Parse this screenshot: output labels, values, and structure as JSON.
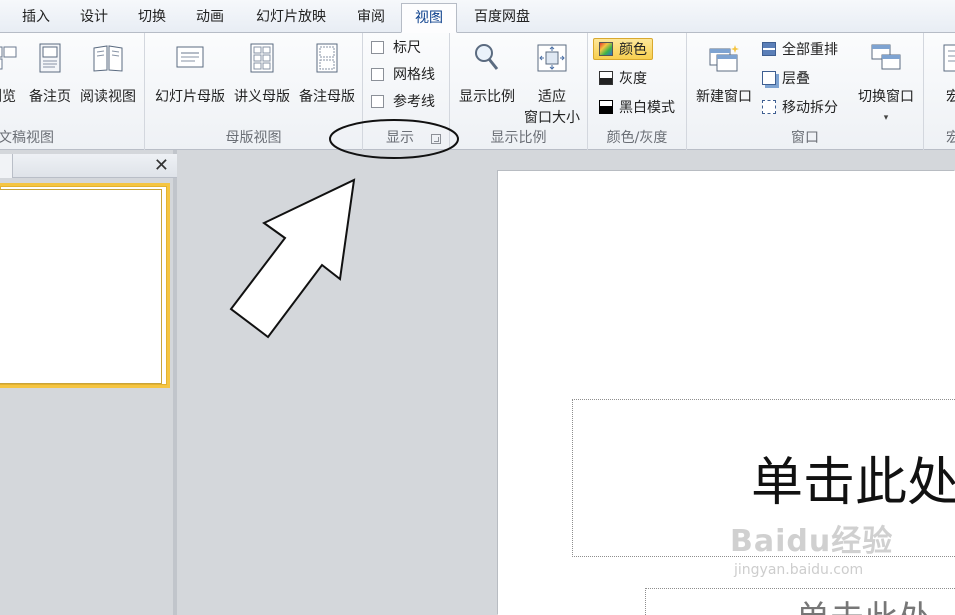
{
  "tabs": [
    {
      "label": "插入"
    },
    {
      "label": "设计"
    },
    {
      "label": "切换"
    },
    {
      "label": "动画"
    },
    {
      "label": "幻灯片放映"
    },
    {
      "label": "审阅"
    },
    {
      "label": "视图",
      "active": true
    },
    {
      "label": "百度网盘"
    }
  ],
  "ribbon": {
    "presentation_views": {
      "label": "文稿视图",
      "buttons": [
        {
          "label": "浏览",
          "icon": "slide-sorter-icon"
        },
        {
          "label": "备注页",
          "icon": "notes-page-icon"
        },
        {
          "label": "阅读视图",
          "icon": "reading-view-icon"
        }
      ]
    },
    "master_views": {
      "label": "母版视图",
      "buttons": [
        {
          "label": "幻灯片母版",
          "icon": "slide-master-icon"
        },
        {
          "label": "讲义母版",
          "icon": "handout-master-icon"
        },
        {
          "label": "备注母版",
          "icon": "notes-master-icon"
        }
      ]
    },
    "show": {
      "label": "显示",
      "checkboxes": [
        {
          "label": "标尺",
          "checked": false
        },
        {
          "label": "网格线",
          "checked": false
        },
        {
          "label": "参考线",
          "checked": false
        }
      ]
    },
    "zoom": {
      "label": "显示比例",
      "zoom_button": "显示比例",
      "fit_line1": "适应",
      "fit_line2": "窗口大小"
    },
    "color": {
      "label": "颜色/灰度",
      "color": "颜色",
      "grayscale": "灰度",
      "bw": "黑白模式"
    },
    "window": {
      "label": "窗口",
      "new_window": "新建窗口",
      "arrange_all": "全部重排",
      "cascade": "层叠",
      "move_split": "移动拆分",
      "switch_windows": "切换窗口"
    },
    "macros": {
      "label": "宏",
      "button": "宏"
    }
  },
  "slide": {
    "title_placeholder": "单击此处",
    "subtitle_placeholder": "单击此处"
  },
  "watermark": {
    "main": "Baidu经验",
    "url": "jingyan.baidu.com"
  },
  "colors": {
    "accent_tab_text": "#0b3f8c",
    "thumbnail_selection": "#f5c542",
    "color_button_fill": "#f8cf4f"
  }
}
